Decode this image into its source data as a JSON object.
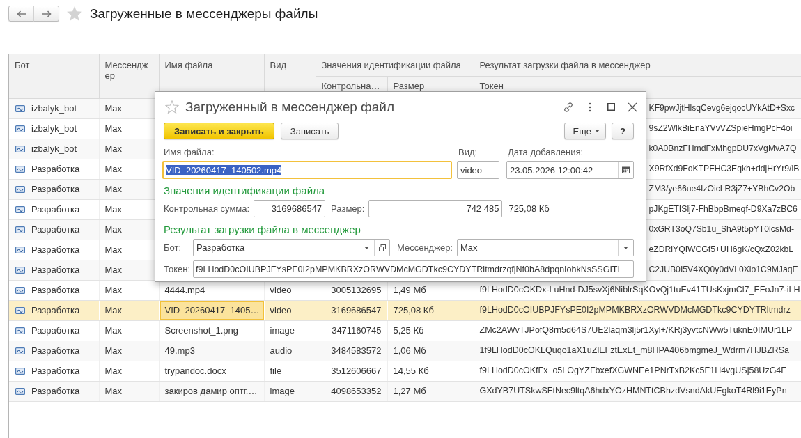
{
  "page": {
    "title": "Загруженные в мессенджеры файлы",
    "favorite": false
  },
  "table": {
    "columns": [
      {
        "label": "Бот"
      },
      {
        "label": "Мессенджер"
      },
      {
        "label": "Имя файла"
      },
      {
        "label": "Вид"
      },
      {
        "label": "Значения идентификации файла",
        "children": [
          {
            "label": "Контрольна…"
          },
          {
            "label": "Размер"
          }
        ]
      },
      {
        "label": "Результат загрузки файла в мессенджер",
        "children": [
          {
            "label": "Токен"
          }
        ]
      }
    ],
    "rows": [
      {
        "bot": "izbalyk_bot",
        "messenger": "Max",
        "token": "KF9pwJjtHlsqCevg6ejqocUYkAtD+Sxc",
        "selected": false
      },
      {
        "bot": "izbalyk_bot",
        "messenger": "Max",
        "token": "9sZ2WlkBiEnaYVvVZSpieHmgPcF4oi",
        "selected": false
      },
      {
        "bot": "izbalyk_bot",
        "messenger": "Max",
        "token": "k0A0BnzFHmdFxMhgpDU7xVgMvA7Q",
        "selected": false
      },
      {
        "bot": "Разработка",
        "messenger": "Max",
        "token": "X9RfXd9FoKTPFHC3Eqkh+ddjHrYr9/lB",
        "selected": false
      },
      {
        "bot": "Разработка",
        "messenger": "Max",
        "token": "ZM3/ye66ue4IzOicLR3jZ7+YBhCv2Ob",
        "selected": false
      },
      {
        "bot": "Разработка",
        "messenger": "Max",
        "token": "pJKgETISlj7-FhBbpBmeqf-D9Xa7zBC6",
        "selected": false
      },
      {
        "bot": "Разработка",
        "messenger": "Max",
        "token": "0xGRT3oQ7Sb1u_ShA9t5pYT0lcsMd-",
        "selected": false
      },
      {
        "bot": "Разработка",
        "messenger": "Max",
        "token": "eZDRiYQIWCGf5+UH6gK/cQxZ02kbL",
        "selected": false
      },
      {
        "bot": "Разработка",
        "messenger": "Max",
        "token": "C2JUB0I5V4XQ0y0dVL0Xlo1C9MJaqE",
        "selected": false
      },
      {
        "bot": "Разработка",
        "messenger": "Max",
        "file_name": "4444.mp4",
        "file_type": "video",
        "checksum": "3005132695",
        "size": "1,49 Мб",
        "token": "f9LHodD0cOKDx-LuHnd-DJ5svXj6NiblrSqKOvQj1tuEv41TUsKxjmCl7_EFoJn7-iLH",
        "selected": false
      },
      {
        "bot": "Разработка",
        "messenger": "Max",
        "file_name": "VID_20260417_1405…",
        "file_type": "video",
        "checksum": "3169686547",
        "size": "725,08 Кб",
        "token": "f9LHodD0cOIUBPJFYsPE0I2pMPMKBRXzORWVDMcMGDTkc9CYDYTRltmdrz",
        "selected": true
      },
      {
        "bot": "Разработка",
        "messenger": "Max",
        "file_name": "Screenshot_1.png",
        "file_type": "image",
        "checksum": "3471160745",
        "size": "5,25 Кб",
        "token": "ZMc2AWvTJPofQ8rn5d64S7UE2laqm3lj5r1Xyl+/KRj3yvtcNWw5TuknE0IMUr1LP",
        "selected": false
      },
      {
        "bot": "Разработка",
        "messenger": "Max",
        "file_name": "49.mp3",
        "file_type": "audio",
        "checksum": "3484583572",
        "size": "1,06 Мб",
        "token": "1f9LHodD0cOKLQuqo1aX1uZlEFztExEt_m8HPA406bmgmeJ_Wdrm7HJBZRSa",
        "selected": false
      },
      {
        "bot": "Разработка",
        "messenger": "Max",
        "file_name": "trypandoc.docx",
        "file_type": "file",
        "checksum": "3512606667",
        "size": "14,55 Кб",
        "token": "f9LHodD0cOKfFx_o5LOgYZFbxefXGWNEe1PNrTxB2Kc5F1H4vgUSj58UzG4E",
        "selected": false
      },
      {
        "bot": "Разработка",
        "messenger": "Max",
        "file_name": "закиров дамир оптг.…",
        "file_type": "image",
        "checksum": "4098653352",
        "size": "1,27 Мб",
        "token": "GXdYB7UTSkwSFtNec9ltqA6hdxYOzHMNTtCBhzdVsndAkUEgkoT4Rl9i1EyPn",
        "selected": false
      }
    ]
  },
  "dialog": {
    "title": "Загруженный в мессенджер файл",
    "favorite": false,
    "buttons": [
      {
        "label": "Записать и закрыть",
        "kind": "primary"
      },
      {
        "label": "Записать",
        "kind": "secondary"
      }
    ],
    "more_button": {
      "label": "Еще"
    },
    "help_button": {
      "label": "?"
    },
    "file_name": {
      "label": "Имя файла:",
      "value": "VID_20260417_140502.mp4",
      "focused": true,
      "text_selected": true
    },
    "file_type": {
      "label": "Вид:",
      "value": "video"
    },
    "date_added": {
      "label": "Дата добавления:",
      "value": "23.05.2026 12:00:42"
    },
    "identification": {
      "title": "Значения идентификации файла",
      "checksum": {
        "label": "Контрольная сумма:",
        "value": "3169686547"
      },
      "size": {
        "label": "Размер:",
        "value": "742 485",
        "readable": "725,08 Кб"
      }
    },
    "upload_result": {
      "title": "Результат загрузки файла в мессенджер",
      "bot": {
        "label": "Бот:",
        "value": "Разработка"
      },
      "messenger": {
        "label": "Мессенджер:",
        "value": "Max"
      },
      "token": {
        "label": "Токен:",
        "value": "f9LHodD0cOIUBPJFYsPE0I2pMPMKBRXzORWVDMcMGDTkc9CYDYTRltmdrzqfjNf0bA8dpqnIohkNsSSGITI"
      }
    }
  }
}
